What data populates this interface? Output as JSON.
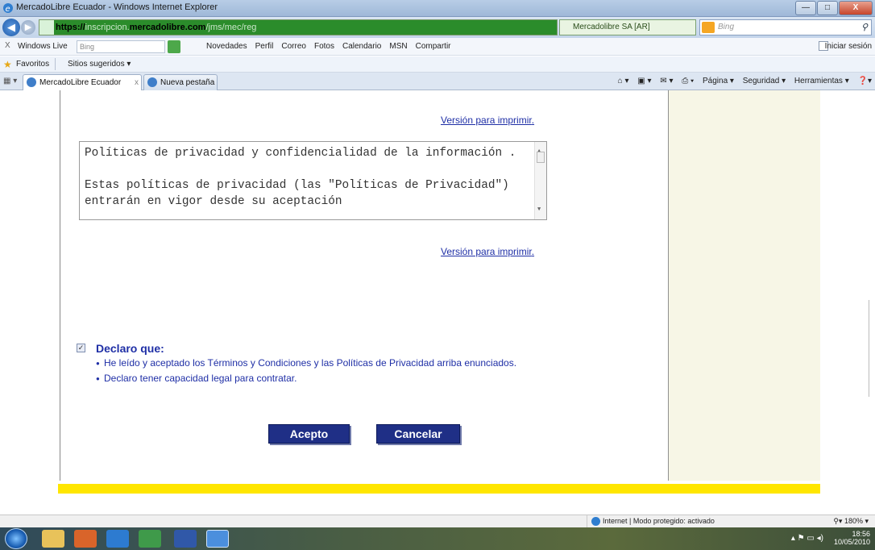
{
  "window": {
    "title": "MercadoLibre Ecuador - Windows Internet Explorer",
    "controls": [
      "—",
      "□",
      "X"
    ]
  },
  "address_bar": {
    "url_prefix": "https://",
    "url_faded": "inscripcion.",
    "url_domain": "mercadolibre.com",
    "url_path": "/jms/mec/reg",
    "site_identity": "Mercadolibre SA [AR]",
    "search_placeholder": "Bing"
  },
  "live_toolbar": {
    "close": "X",
    "brand": "Windows Live",
    "search_value": "Bing",
    "links": [
      "Novedades",
      "Perfil",
      "Correo",
      "Fotos",
      "Calendario",
      "MSN",
      "Compartir"
    ],
    "sign_in": "Iniciar sesión"
  },
  "favorites_bar": {
    "favorites": "Favoritos",
    "suggested": "Sitios sugeridos ▾"
  },
  "tabs": [
    {
      "label": "MercadoLibre Ecuador",
      "close": "x"
    },
    {
      "label": "Nueva pestaña"
    }
  ],
  "command_bar": {
    "page": "Página ▾",
    "security": "Seguridad ▾",
    "tools": "Herramientas ▾"
  },
  "page": {
    "print_link": "Versión para imprimir",
    "policy_text": [
      "Políticas de privacidad y confidencialidad de la información .",
      "Estas políticas de privacidad (las \"Políticas de Privacidad\") entrarán en vigor desde su aceptación"
    ],
    "declare": {
      "checked": true,
      "heading": "Declaro que:",
      "items": [
        "He leído y aceptado los Términos y Condiciones y las Políticas de Privacidad arriba enunciados.",
        "Declaro tener capacidad legal para contratar."
      ]
    },
    "accept_button": "Acepto",
    "cancel_button": "Cancelar"
  },
  "status_bar": {
    "zone": "Internet | Modo protegido: activado",
    "zoom": "180%"
  },
  "taskbar": {
    "time": "18:56",
    "date": "10/05/2010"
  },
  "colors": {
    "link": "#1f2fa6",
    "button_bg": "#1f2f86",
    "yellow_bar": "#ffe600",
    "side_panel": "#f7f6e6"
  }
}
